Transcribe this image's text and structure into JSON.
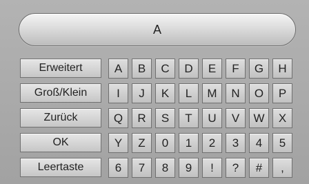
{
  "display": {
    "value": "A"
  },
  "function_keys": [
    {
      "name": "erweitert-button",
      "label": "Erweitert"
    },
    {
      "name": "gross-klein-button",
      "label": "Groß/Klein"
    },
    {
      "name": "zurueck-button",
      "label": "Zurück"
    },
    {
      "name": "ok-button",
      "label": "OK"
    },
    {
      "name": "leertaste-button",
      "label": "Leertaste"
    }
  ],
  "keyboard_rows": [
    [
      "A",
      "B",
      "C",
      "D",
      "E",
      "F",
      "G",
      "H"
    ],
    [
      "I",
      "J",
      "K",
      "L",
      "M",
      "N",
      "O",
      "P"
    ],
    [
      "Q",
      "R",
      "S",
      "T",
      "U",
      "V",
      "W",
      "X"
    ],
    [
      "Y",
      "Z",
      "0",
      "1",
      "2",
      "3",
      "4",
      "5"
    ],
    [
      "6",
      "7",
      "8",
      "9",
      "!",
      "?",
      "#",
      ","
    ]
  ]
}
